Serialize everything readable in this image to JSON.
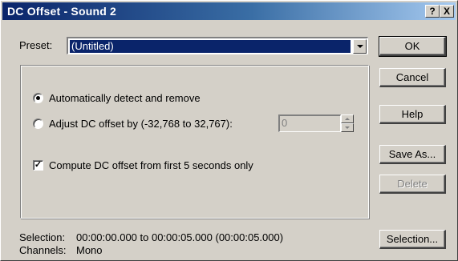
{
  "window": {
    "title": "DC Offset - Sound 2",
    "help_button": "?",
    "close_button": "X"
  },
  "preset": {
    "label": "Preset:",
    "value": "(Untitled)"
  },
  "buttons": {
    "ok": "OK",
    "cancel": "Cancel",
    "help": "Help",
    "save_as": "Save As...",
    "delete": "Delete",
    "selection": "Selection..."
  },
  "options": {
    "auto_detect": {
      "label": "Automatically detect and remove",
      "selected": true
    },
    "adjust": {
      "label": "Adjust DC offset by (-32,768 to 32,767):",
      "selected": false,
      "value": "0"
    },
    "compute_first": {
      "label": "Compute DC offset from first 5 seconds only",
      "checked": true
    }
  },
  "status": {
    "selection_label": "Selection:",
    "selection_value": "00:00:00.000 to 00:00:05.000 (00:00:05.000)",
    "channels_label": "Channels:",
    "channels_value": "Mono"
  }
}
